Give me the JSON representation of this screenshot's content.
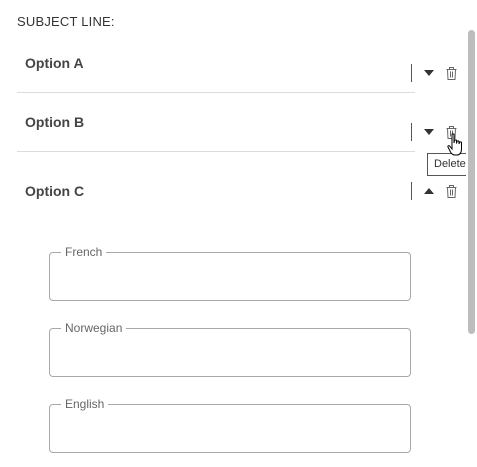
{
  "subject": {
    "label": "SUBJECT LINE:"
  },
  "options": [
    {
      "title": "Option A",
      "expanded": false
    },
    {
      "title": "Option B",
      "expanded": false
    },
    {
      "title": "Option C",
      "expanded": true
    }
  ],
  "tooltip": {
    "text": "Delete"
  },
  "fields": [
    {
      "legend": "French",
      "value": ""
    },
    {
      "legend": "Norwegian",
      "value": ""
    },
    {
      "legend": "English",
      "value": ""
    }
  ],
  "icons": {
    "collapsed": "caret-down-icon",
    "expanded": "caret-up-icon",
    "delete": "trash-icon"
  },
  "colors": {
    "text": "#444444",
    "divider": "#dcdcdc",
    "field_border": "#a8a8a8",
    "scroll_thumb": "#bdbdbd"
  }
}
